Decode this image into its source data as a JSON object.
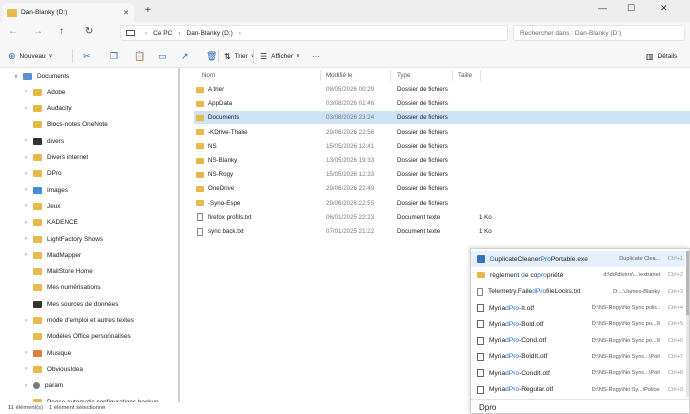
{
  "window": {
    "tab_title": "Dan-Blanky (D:)",
    "tab_close": "✕",
    "tab_add": "+",
    "minimize": "—",
    "maximize": "☐",
    "close": "✕"
  },
  "address": {
    "breadcrumb": [
      "Ce PC",
      "Dan-Blanky (D:)"
    ],
    "search_placeholder": "Rechercher dans : Dan-Blanky (D:)"
  },
  "toolbar": {
    "new_label": "Nouveau",
    "sort_label": "Trier",
    "view_label": "Afficher",
    "details_label": "Détails",
    "more_label": "···"
  },
  "nav_items": [
    {
      "label": "Documents",
      "chevron": "∨",
      "icon": "docs"
    },
    {
      "label": "Adobe",
      "chevron": "›",
      "icon": "folder"
    },
    {
      "label": "Audacity",
      "chevron": "›",
      "icon": "folder"
    },
    {
      "label": "Blocs-notes OneNote",
      "chevron": "",
      "icon": "folder"
    },
    {
      "label": "divers",
      "chevron": "›",
      "icon": "dark"
    },
    {
      "label": "Divers internet",
      "chevron": "›",
      "icon": "folder"
    },
    {
      "label": "DPro",
      "chevron": "›",
      "icon": "folder"
    },
    {
      "label": "Images",
      "chevron": "›",
      "icon": "img"
    },
    {
      "label": "Jeux",
      "chevron": "›",
      "icon": "folder"
    },
    {
      "label": "KADENCE",
      "chevron": "›",
      "icon": "folder"
    },
    {
      "label": "LightFactory Shows",
      "chevron": "›",
      "icon": "folder"
    },
    {
      "label": "MadMapper",
      "chevron": "›",
      "icon": "folder"
    },
    {
      "label": "MailStore Home",
      "chevron": "",
      "icon": "folder"
    },
    {
      "label": "Mes numérisations",
      "chevron": "",
      "icon": "folder"
    },
    {
      "label": "Mes sources de données",
      "chevron": "",
      "icon": "dark"
    },
    {
      "label": "mode d'emploi et autres textes",
      "chevron": "›",
      "icon": "folder"
    },
    {
      "label": "Modèles Office personnalisés",
      "chevron": "",
      "icon": "folder"
    },
    {
      "label": "Musique",
      "chevron": "›",
      "icon": "mus"
    },
    {
      "label": "ObviousIdea",
      "chevron": "›",
      "icon": "folder"
    },
    {
      "label": "param",
      "chevron": "›",
      "icon": "gear"
    },
    {
      "label": "Peace automatic configurations backup",
      "chevron": "",
      "icon": "folder"
    }
  ],
  "columns": {
    "name": "Nom",
    "modified": "Modifié le",
    "type": "Type",
    "size": "Taille"
  },
  "files": [
    {
      "name": "A trier",
      "modified": "08/05/2026 00:29",
      "type": "Dossier de fichiers",
      "size": "",
      "kind": "folder"
    },
    {
      "name": "AppData",
      "modified": "03/08/2026 01:46",
      "type": "Dossier de fichiers",
      "size": "",
      "kind": "folder"
    },
    {
      "name": "Documents",
      "modified": "03/08/2026 23:24",
      "type": "Dossier de fichiers",
      "size": "",
      "kind": "folder"
    },
    {
      "name": "-KDrive-Thalie",
      "modified": "29/06/2026 22:56",
      "type": "Dossier de fichiers",
      "size": "",
      "kind": "folder"
    },
    {
      "name": "NS",
      "modified": "15/05/2026 12:41",
      "type": "Dossier de fichiers",
      "size": "",
      "kind": "folder"
    },
    {
      "name": "NS-Blanky",
      "modified": "13/05/2026 19:33",
      "type": "Dossier de fichiers",
      "size": "",
      "kind": "folder"
    },
    {
      "name": "NS-Rogy",
      "modified": "15/05/2026 12:33",
      "type": "Dossier de fichiers",
      "size": "",
      "kind": "folder"
    },
    {
      "name": "OneDrive",
      "modified": "29/06/2026 22:49",
      "type": "Dossier de fichiers",
      "size": "",
      "kind": "folder"
    },
    {
      "name": "-Syno-Espe",
      "modified": "29/06/2026 22:55",
      "type": "Dossier de fichiers",
      "size": "",
      "kind": "folder"
    },
    {
      "name": "firefox profils.txt",
      "modified": "06/01/2025 22:23",
      "type": "Document texte",
      "size": "1 Ko",
      "kind": "file"
    },
    {
      "name": "sync back.txt",
      "modified": "07/01/2025 21:22",
      "type": "Document texte",
      "size": "1 Ko",
      "kind": "file"
    }
  ],
  "selected_index": 2,
  "popup": {
    "results": [
      {
        "pre": "",
        "match1": "D",
        "mid": "uplicateCleaner",
        "match2": "Pro",
        "post": "Portable.exe",
        "path": "Duplicate Clea...",
        "key": "Ctrl+1",
        "icon": "exe"
      },
      {
        "pre": "règlement ",
        "match1": "d",
        "mid": "e co",
        "match2": "pro",
        "post": "priété",
        "path": "d:\\dd\\divers\\...\\extranet",
        "key": "Ctrl+2",
        "icon": "fold"
      },
      {
        "pre": "Telemetry.Faile",
        "match1": "d",
        "mid": "",
        "match2": "Pro",
        "post": "fileLocks.txt",
        "path": "D:...\\James-Blanky",
        "key": "Ctrl+3",
        "icon": "txt"
      },
      {
        "pre": "Myria",
        "match1": "d",
        "mid": "",
        "match2": "Pro",
        "post": "-It.otf",
        "path": "D:\\NS-Rogy\\No Sync polic...\\Polices",
        "key": "Ctrl+4",
        "icon": "font"
      },
      {
        "pre": "Myria",
        "match1": "d",
        "mid": "",
        "match2": "Pro",
        "post": "-Bold.otf",
        "path": "D:\\NS-Rogy\\No Sync po...\\Polices",
        "key": "Ctrl+5",
        "icon": "font"
      },
      {
        "pre": "Myria",
        "match1": "d",
        "mid": "",
        "match2": "Pro",
        "post": "-Cond.otf",
        "path": "D:\\NS-Rogy\\No Sync po...\\Polices",
        "key": "Ctrl+6",
        "icon": "font"
      },
      {
        "pre": "Myria",
        "match1": "d",
        "mid": "",
        "match2": "Pro",
        "post": "-BoldIt.otf",
        "path": "D:\\NS-Rogy\\No Sync...\\Polices",
        "key": "Ctrl+7",
        "icon": "font"
      },
      {
        "pre": "Myria",
        "match1": "d",
        "mid": "",
        "match2": "Pro",
        "post": "-CondIt.otf",
        "path": "D:\\NS-Rogy\\No Sync...\\Polices",
        "key": "Ctrl+8",
        "icon": "font"
      },
      {
        "pre": "Myria",
        "match1": "d",
        "mid": "",
        "match2": "Pro",
        "post": "-Regular.otf",
        "path": "D:\\NS-Rogy\\No Sy...\\Polices",
        "key": "Ctrl+9",
        "icon": "font"
      }
    ],
    "query": "Dpro"
  },
  "status": {
    "count": "11 élément(s)",
    "selected": "1 élément sélectionné"
  }
}
